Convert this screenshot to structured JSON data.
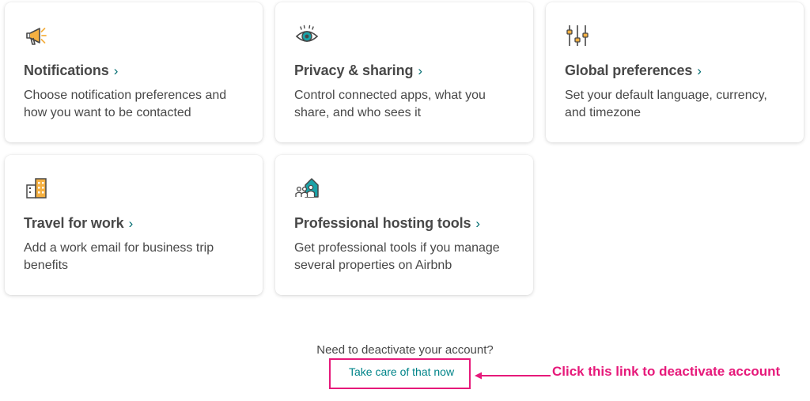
{
  "cards": [
    {
      "icon": "megaphone-icon",
      "title": "Notifications",
      "chevron": "›",
      "description": "Choose notification preferences and how you want to be contacted"
    },
    {
      "icon": "eye-icon",
      "title": "Privacy & sharing",
      "chevron": "›",
      "description": "Control connected apps, what you share, and who sees it"
    },
    {
      "icon": "sliders-icon",
      "title": "Global preferences",
      "chevron": "›",
      "description": "Set your default language, currency, and timezone"
    },
    {
      "icon": "office-building-icon",
      "title": "Travel for work",
      "chevron": "›",
      "description": "Add a work email for business trip benefits"
    },
    {
      "icon": "hosting-house-icon",
      "title": "Professional hosting tools",
      "chevron": "›",
      "description": "Get professional tools if you manage several properties on Airbnb"
    }
  ],
  "deactivate": {
    "prompt": "Need to deactivate your account?",
    "link_label": "Take care of that now"
  },
  "annotation": {
    "text": "Click this link to deactivate account",
    "color": "#e6197a"
  },
  "colors": {
    "accent_teal": "#008489",
    "text": "#484848",
    "annotation_pink": "#e6197a"
  }
}
